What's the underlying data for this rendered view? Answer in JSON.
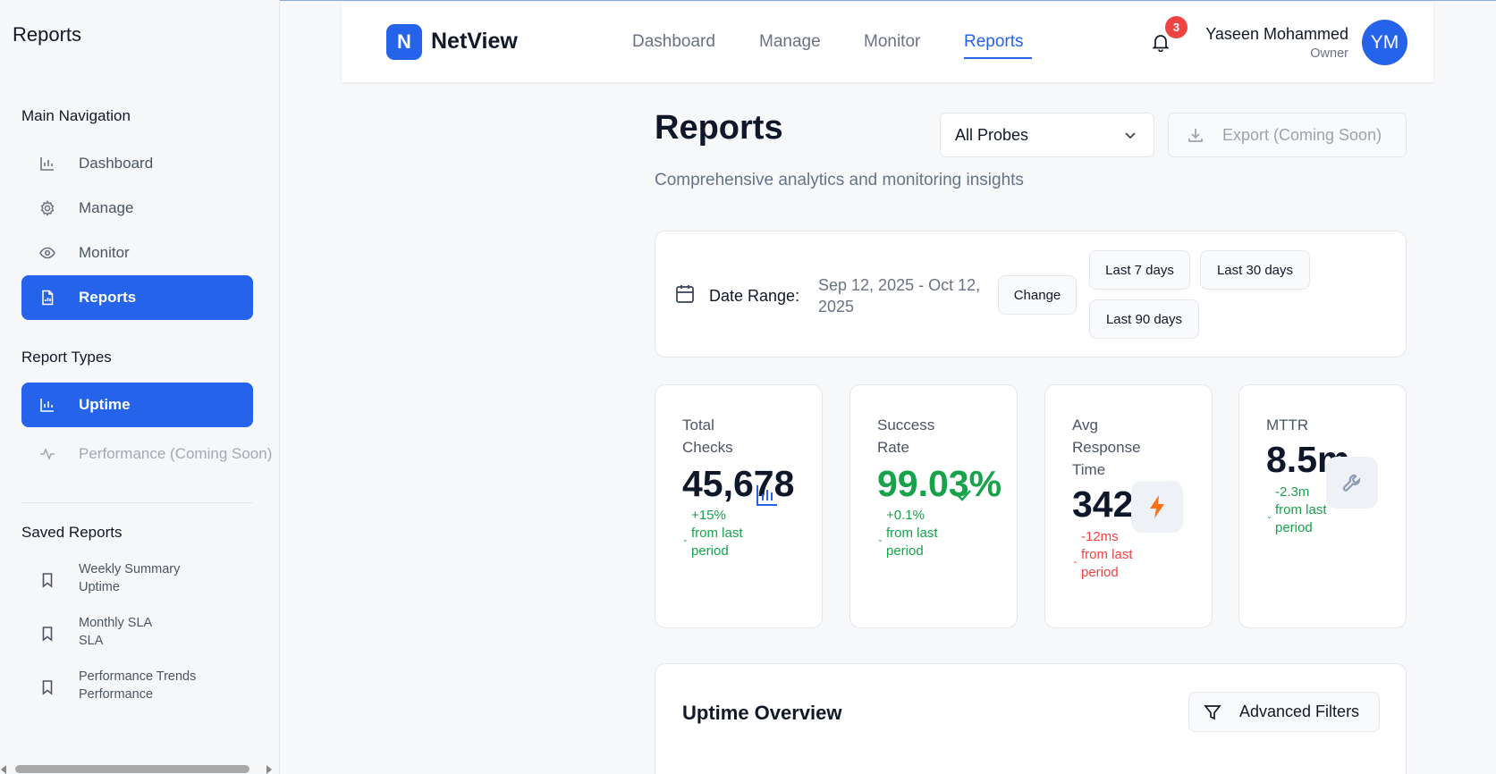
{
  "sidebar": {
    "title": "Reports",
    "main_nav_heading": "Main Navigation",
    "main_nav": [
      {
        "label": "Dashboard",
        "icon": "bar-chart-icon"
      },
      {
        "label": "Manage",
        "icon": "gear-icon"
      },
      {
        "label": "Monitor",
        "icon": "eye-icon"
      },
      {
        "label": "Reports",
        "icon": "file-chart-icon",
        "active": true
      }
    ],
    "report_types_heading": "Report Types",
    "report_types": [
      {
        "label": "Uptime",
        "icon": "bar-chart-icon",
        "active": true
      },
      {
        "label": "Performance (Coming Soon)",
        "icon": "activity-icon",
        "disabled": true
      }
    ],
    "saved_heading": "Saved Reports",
    "saved_reports": [
      {
        "name": "Weekly Summary",
        "type": "Uptime"
      },
      {
        "name": "Monthly SLA",
        "type": "SLA"
      },
      {
        "name": "Performance Trends",
        "type": "Performance"
      }
    ]
  },
  "header": {
    "logo_letter": "N",
    "logo_text": "NetView",
    "nav": [
      "Dashboard",
      "Manage",
      "Monitor",
      "Reports"
    ],
    "active_nav": "Reports",
    "notification_count": "3",
    "user_name": "Yaseen Mohammed",
    "user_role": "Owner",
    "avatar_initials": "YM"
  },
  "main": {
    "title": "Reports",
    "subtitle": "Comprehensive analytics and monitoring insights",
    "probe_select": "All Probes",
    "export_label": "Export (Coming Soon)",
    "date_range": {
      "label": "Date Range:",
      "value": "Sep 12, 2025 - Oct 12, 2025",
      "change_label": "Change",
      "presets": [
        "Last 7 days",
        "Last 30 days",
        "Last 90 days"
      ]
    },
    "metrics": [
      {
        "label": "Total Checks",
        "value": "45,678",
        "change": "+15% from last period",
        "trend": "up"
      },
      {
        "label": "Success Rate",
        "value": "99.03%",
        "change": "+0.1% from last period",
        "trend": "up"
      },
      {
        "label": "Avg Response Time",
        "value": "342",
        "change": "-12ms from last period",
        "trend": "down"
      },
      {
        "label": "MTTR",
        "value": "8.5m",
        "change": "-2.3m from last period",
        "trend": "up"
      }
    ],
    "overview_title": "Uptime Overview",
    "filters_label": "Advanced Filters"
  },
  "colors": {
    "accent": "#2563eb",
    "success": "#16a34a",
    "danger": "#ef4444"
  }
}
